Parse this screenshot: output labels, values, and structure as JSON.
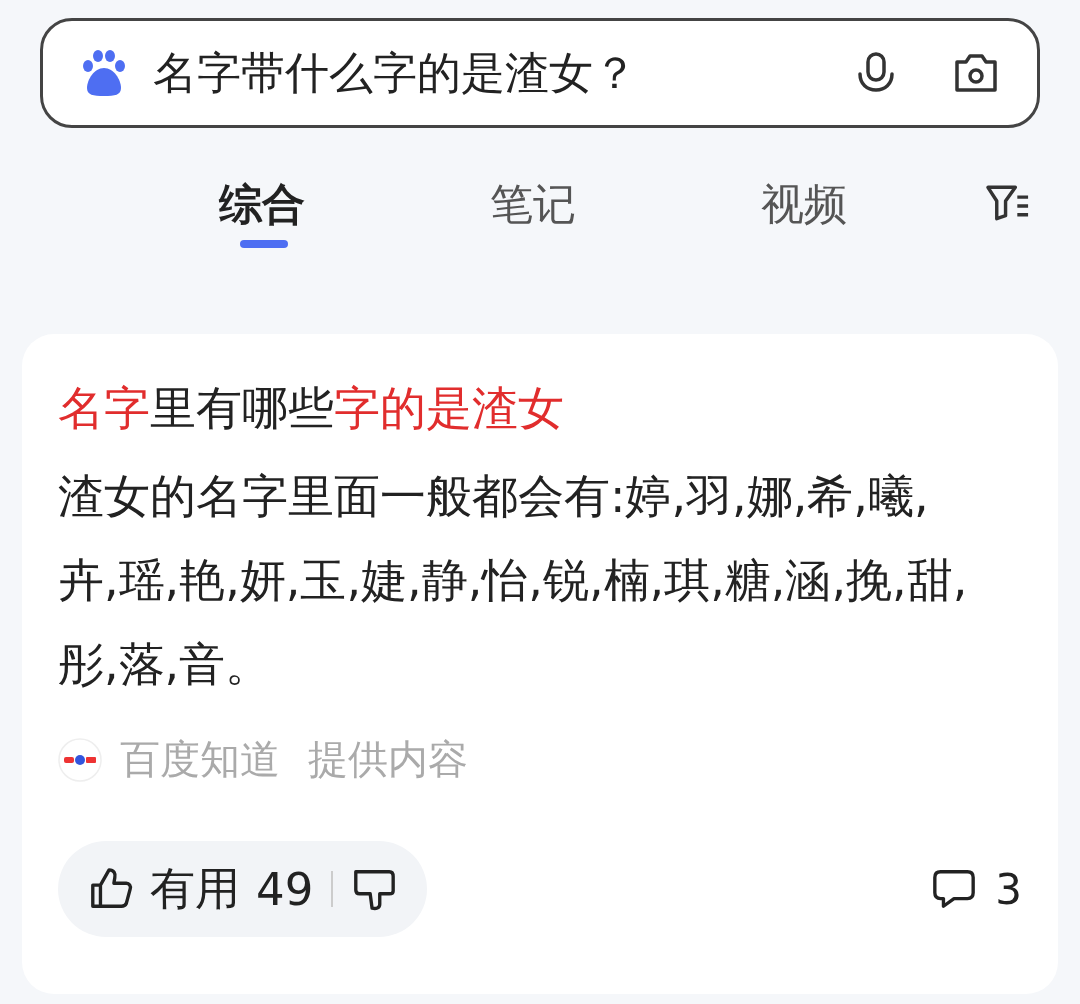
{
  "search": {
    "value": "名字带什么字的是渣女？"
  },
  "tabs": [
    {
      "label": "综合",
      "selected": true
    },
    {
      "label": "笔记",
      "selected": false
    },
    {
      "label": "视频",
      "selected": false
    }
  ],
  "card": {
    "title": [
      {
        "text": "名字",
        "highlight": true
      },
      {
        "text": "里有哪些",
        "highlight": false
      },
      {
        "text": "字的是渣女",
        "highlight": true
      }
    ],
    "body": "渣女的名字里面一般都会有:婷,羽,娜,希,曦,卉,瑶,艳,妍,玉,婕,静,怡,锐,楠,琪,糖,涵,挽,甜,彤,落,音。",
    "source": {
      "name": "百度知道",
      "note": "提供内容"
    },
    "useful_label": "有用",
    "useful_count": "49",
    "comment_count": "3"
  }
}
